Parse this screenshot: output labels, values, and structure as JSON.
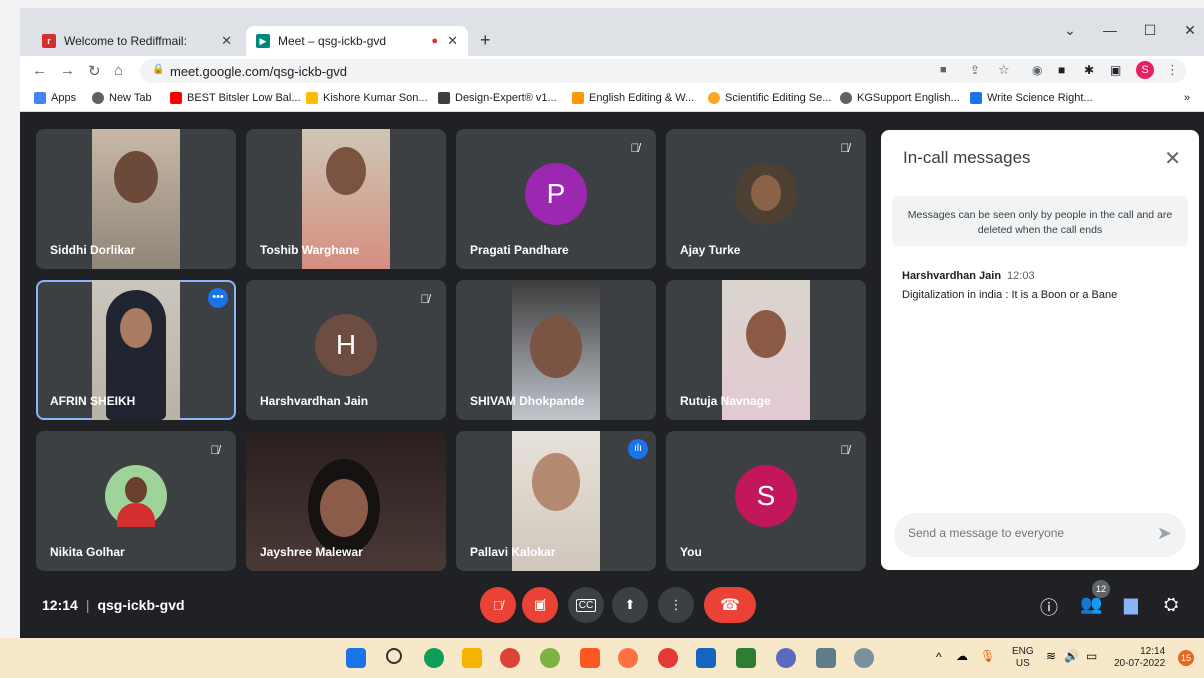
{
  "browser": {
    "tabs": [
      {
        "label": "Welcome to Rediffmail:",
        "active": false
      },
      {
        "label": "Meet – qsg-ickb-gvd",
        "active": true
      }
    ],
    "new_tab": "+",
    "url": "meet.google.com/qsg-ickb-gvd",
    "bookmarks": [
      {
        "label": "Apps",
        "icon": "apps-icon"
      },
      {
        "label": "New Tab",
        "icon": "globe-icon"
      },
      {
        "label": "BEST Bitsler Low Bal...",
        "icon": "youtube-icon"
      },
      {
        "label": "Kishore Kumar Son...",
        "icon": "music-icon"
      },
      {
        "label": "Design-Expert® v1...",
        "icon": "doc-icon"
      },
      {
        "label": "English Editing & W...",
        "icon": "pen-icon"
      },
      {
        "label": "Scientific Editing Se...",
        "icon": "edit-icon"
      },
      {
        "label": "KGSupport English...",
        "icon": "globe-icon"
      },
      {
        "label": "Write Science Right...",
        "icon": "book-icon"
      }
    ],
    "profile_initial": "S"
  },
  "participants": [
    {
      "name": "Siddhi Dorlikar",
      "type": "video",
      "muted": false
    },
    {
      "name": "Toshib Warghane",
      "type": "video",
      "muted": false
    },
    {
      "name": "Pragati Pandhare",
      "type": "avatar",
      "initial": "P",
      "color": "#9c27b0",
      "muted": true
    },
    {
      "name": "Ajay Turke",
      "type": "photo",
      "muted": true
    },
    {
      "name": "AFRIN SHEIKH",
      "type": "video",
      "muted": false,
      "active": true
    },
    {
      "name": "Harshvardhan Jain",
      "type": "avatar",
      "initial": "H",
      "color": "#6d4c41",
      "muted": true
    },
    {
      "name": "SHIVAM Dhokpande",
      "type": "video",
      "muted": false
    },
    {
      "name": "Rutuja Navnage",
      "type": "video",
      "muted": false
    },
    {
      "name": "Nikita Golhar",
      "type": "photo",
      "muted": true
    },
    {
      "name": "Jayshree Malewar",
      "type": "video",
      "muted": true
    },
    {
      "name": "Pallavi Kalokar",
      "type": "video",
      "muted": false,
      "speaking": true
    },
    {
      "name": "You",
      "type": "avatar",
      "initial": "S",
      "color": "#c2185b",
      "muted": true
    }
  ],
  "chat": {
    "title": "In-call messages",
    "notice": "Messages can be seen only by people in the call and are deleted when the call ends",
    "messages": [
      {
        "sender": "Harshvardhan Jain",
        "time": "12:03",
        "text": "Digitalization in india : It is a Boon or a Bane"
      }
    ],
    "input_placeholder": "Send a message to everyone"
  },
  "meeting": {
    "time": "12:14",
    "code": "qsg-ickb-gvd",
    "people_count": "12"
  },
  "taskbar": {
    "lang_top": "ENG",
    "lang_bottom": "US",
    "time": "12:14",
    "date": "20-07-2022",
    "notifications": "15"
  },
  "colors": {
    "meet_bg": "#202124",
    "tile_bg": "#3c4043",
    "hangup": "#ea4335",
    "accent": "#8ab4f8"
  }
}
